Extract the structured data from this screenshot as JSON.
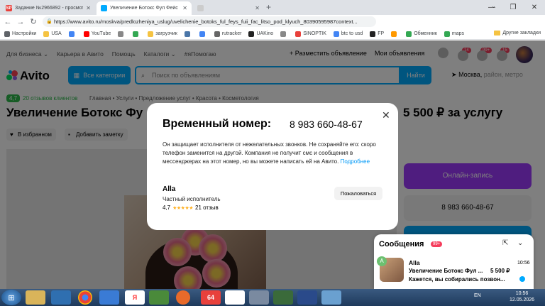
{
  "browser": {
    "tabs": [
      {
        "label": "Задание №2966892 - просмотр з",
        "favicon": "SP",
        "color": "#e8413c"
      },
      {
        "label": "Увеличение Ботокс Фул Фейс Fuii",
        "favicon": "",
        "color": "#00aaff"
      },
      {
        "label": "",
        "favicon": "",
        "color": "#cccccc"
      }
    ],
    "url": "https://www.avito.ru/moskva/predlozheniya_uslug/uvelichenie_botoks_ful_feys_fuii_fac_litso_pod_klyuch_80390595987context...",
    "window_buttons": [
      "—",
      "❐",
      "✕"
    ],
    "bookmarks": [
      {
        "label": "Настройки",
        "color": "#5f6368"
      },
      {
        "label": "USA",
        "color": "#f5c342"
      },
      {
        "label": "",
        "color": "#4285f4"
      },
      {
        "label": "YouTube",
        "color": "#ff0000"
      },
      {
        "label": "",
        "color": "#888888"
      },
      {
        "label": "",
        "color": "#34a853"
      },
      {
        "label": "загрузчик",
        "color": "#f5c342"
      },
      {
        "label": "",
        "color": "#4a76a8"
      },
      {
        "label": "",
        "color": "#4285f4"
      },
      {
        "label": "rutracker",
        "color": "#666666"
      },
      {
        "label": "UAKino",
        "color": "#222222"
      },
      {
        "label": "",
        "color": "#888888"
      },
      {
        "label": "SINOPTIK",
        "color": "#e8413c"
      },
      {
        "label": "btc to usd",
        "color": "#4285f4"
      },
      {
        "label": "FP",
        "color": "#222222"
      },
      {
        "label": "",
        "color": "#ff9900"
      },
      {
        "label": "Обменник",
        "color": "#34a853"
      },
      {
        "label": "maps",
        "color": "#34a853"
      }
    ],
    "other_bookmarks": "Другие закладки"
  },
  "site": {
    "topnav": [
      "Для бизнеса ⌄",
      "Карьера в Авито",
      "Помощь",
      "Каталоги ⌄",
      "#яПомогаю"
    ],
    "post_ad": "+ Разместить объявление",
    "my_ads": "Мои объявления",
    "badges": [
      "14",
      "99+",
      "15"
    ],
    "logo": "Avito",
    "categories_button": "Все категории",
    "search_placeholder": "Поиск по объявлениям",
    "find_button": "Найти",
    "location": "Москва,",
    "location_hint": " район, метро",
    "rating": "4,7",
    "reviews": "20 отзывов клиентов",
    "breadcrumbs": "Главная  •  Услуги  •  Предложение услуг  •  Красота  •  Косметология",
    "title": "Увеличение Ботокс Фу",
    "price": "5 500 ₽ за услугу",
    "favorite": "В избранном",
    "add_note": "Добавить заметку",
    "book_button": "Онлайн-запись",
    "phone_button": "8 983 660-48-67"
  },
  "modal": {
    "title": "Временный номер:",
    "number": "8 983 660-48-67",
    "text": "Он защищает исполнителя от нежелательных звонков. Не сохраняйте его: скоро телефон заменится на другой. Компания не получит смс и сообщения в мессенджерах на этот номер, но вы можете написать ей на Авито.",
    "more_link": "Подробнее",
    "seller_name": "Alla",
    "seller_role": "Частный исполнитель",
    "seller_rating": "4,7",
    "stars": "★★★★★",
    "reviews": "21 отзыв",
    "complain_button": "Пожаловаться",
    "close": "✕"
  },
  "messages": {
    "title": "Сообщения",
    "badge": "99+",
    "avatar_letter": "A",
    "name": "Alla",
    "time": "10:56",
    "subject": "Увеличение Ботокс Фул ...",
    "price": "5 500 ₽",
    "preview": "Кажется, вы собирались позвон..."
  },
  "taskbar": {
    "lang": "EN",
    "time": "10:56",
    "date": "12.05.2026"
  }
}
